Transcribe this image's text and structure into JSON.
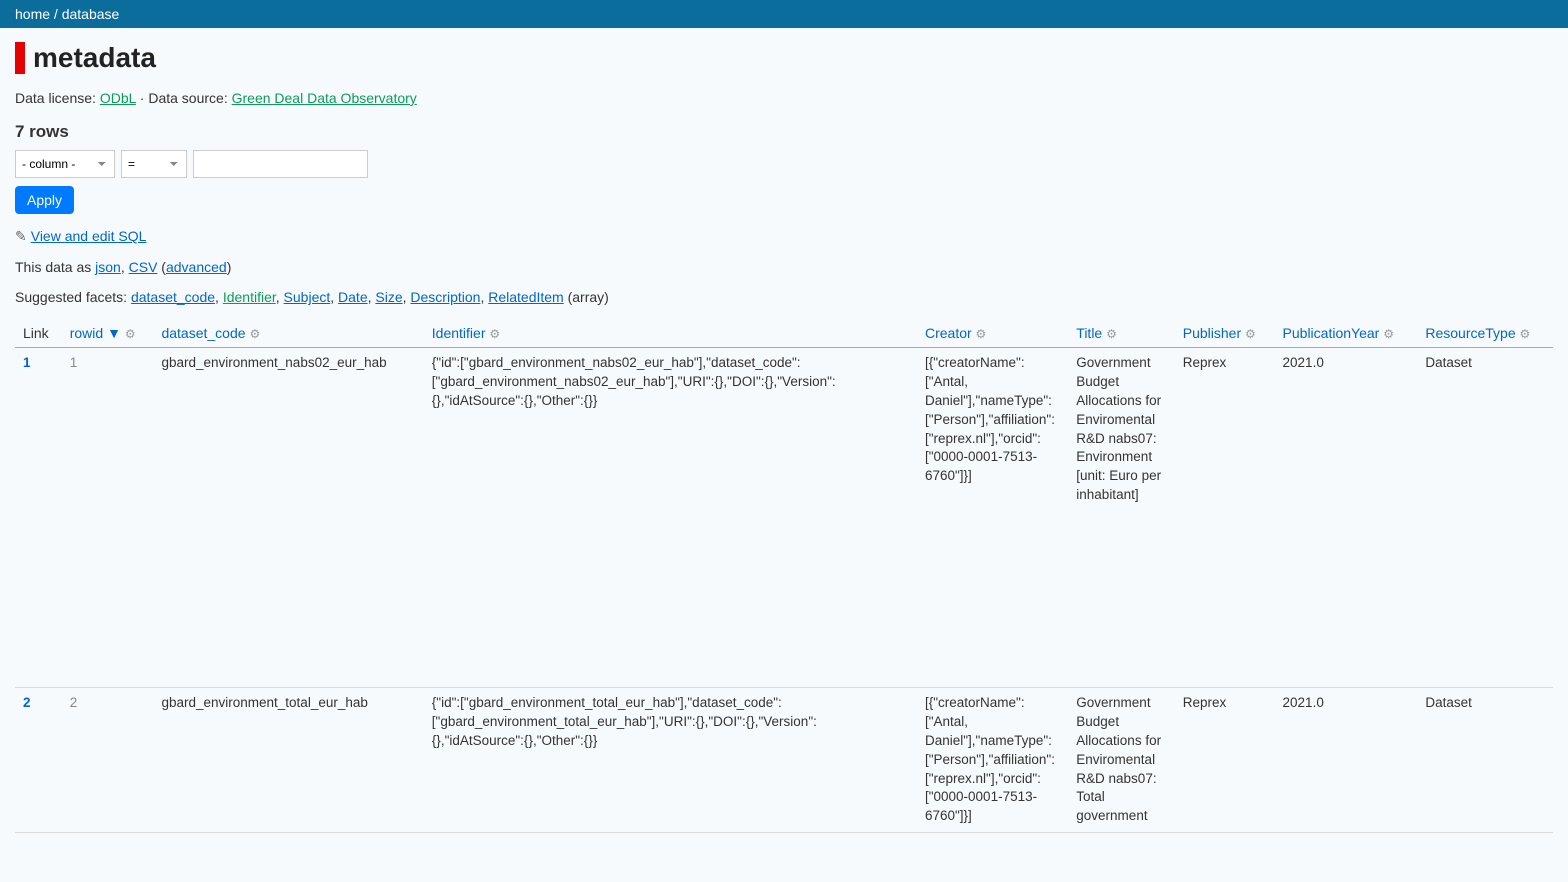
{
  "breadcrumb": {
    "home": "home",
    "sep": " / ",
    "db": "database"
  },
  "title": "metadata",
  "license": {
    "label": "Data license: ",
    "name": "ODbL",
    "sep": " · ",
    "src_label": "Data source: ",
    "src_name": "Green Deal Data Observatory"
  },
  "rows_label": "7 rows",
  "filter": {
    "col_placeholder": "- column -",
    "op_placeholder": "="
  },
  "apply_label": "Apply",
  "sql_link": "View and edit SQL",
  "export": {
    "prefix": "This data as ",
    "json": "json",
    "csv": "CSV",
    "advanced": "advanced"
  },
  "facets": {
    "prefix": "Suggested facets: ",
    "items": [
      "dataset_code",
      "Identifier",
      "Subject",
      "Date",
      "Size",
      "Description",
      "RelatedItem"
    ],
    "suffix": " (array)"
  },
  "columns": [
    "Link",
    "rowid ▼",
    "dataset_code",
    "Identifier",
    "Creator",
    "Title",
    "Publisher",
    "PublicationYear",
    "ResourceType"
  ],
  "gear": "⚙",
  "rows": [
    {
      "link": "1",
      "rowid": "1",
      "dataset_code": "gbard_environment_nabs02_eur_hab",
      "identifier": "{\"id\":[\"gbard_environment_nabs02_eur_hab\"],\"dataset_code\":[\"gbard_environment_nabs02_eur_hab\"],\"URI\":{},\"DOI\":{},\"Version\":{},\"idAtSource\":{},\"Other\":{}}",
      "creator": "[{\"creatorName\":[\"Antal, Daniel\"],\"nameType\":[\"Person\"],\"affiliation\":[\"reprex.nl\"],\"orcid\":[\"0000-0001-7513-6760\"]}]",
      "title": "Government Budget Allocations for Enviromental R&D nabs07: Environment [unit: Euro per inhabitant]",
      "publisher": "Reprex",
      "year": "2021.0",
      "rtype": "Dataset"
    },
    {
      "link": "2",
      "rowid": "2",
      "dataset_code": "gbard_environment_total_eur_hab",
      "identifier": "{\"id\":[\"gbard_environment_total_eur_hab\"],\"dataset_code\":[\"gbard_environment_total_eur_hab\"],\"URI\":{},\"DOI\":{},\"Version\":{},\"idAtSource\":{},\"Other\":{}}",
      "creator": "[{\"creatorName\":[\"Antal, Daniel\"],\"nameType\":[\"Person\"],\"affiliation\":[\"reprex.nl\"],\"orcid\":[\"0000-0001-7513-6760\"]}]",
      "title": "Government Budget Allocations for Enviromental R&D nabs07: Total government",
      "publisher": "Reprex",
      "year": "2021.0",
      "rtype": "Dataset"
    }
  ]
}
